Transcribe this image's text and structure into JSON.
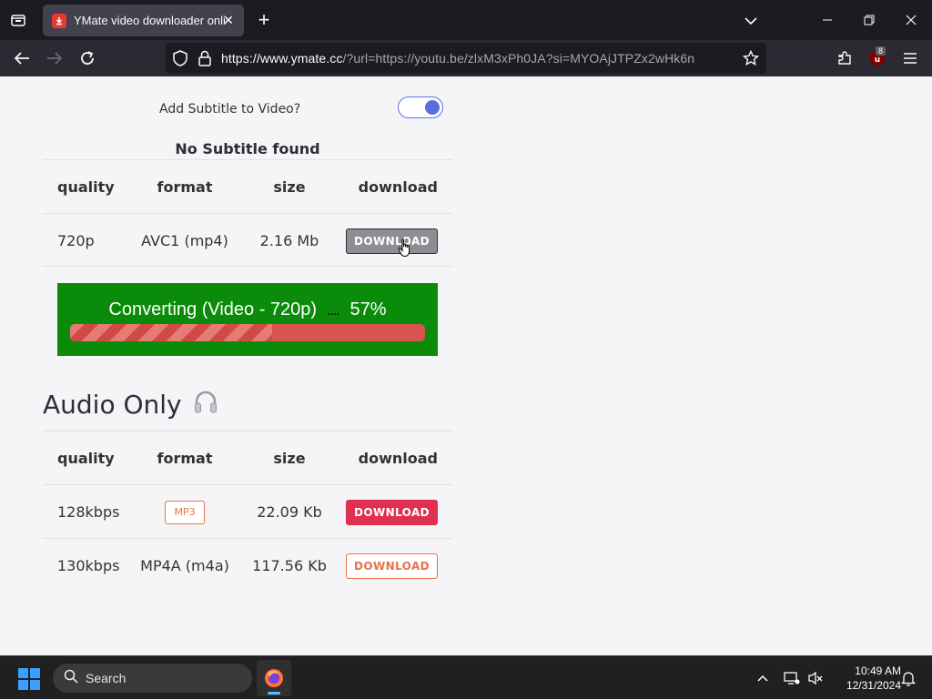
{
  "browser": {
    "tab_title": "YMate video downloader online",
    "url_host": "https://www.ymate.cc",
    "url_rest": "/?url=https://youtu.be/zlxM3xPh0JA?si=MYOAjJTPZx2wHk6n",
    "extension_badge": "8"
  },
  "subtitle": {
    "label": "Add Subtitle to Video?",
    "toggle_on": true,
    "status": "No Subtitle found"
  },
  "video_table": {
    "headers": [
      "quality",
      "format",
      "size",
      "download"
    ],
    "rows": [
      {
        "quality": "720p",
        "format": "AVC1 (mp4)",
        "size": "2.16 Mb",
        "button": "DOWNLOAD"
      }
    ]
  },
  "progress": {
    "label": "Converting (Video - 720p)",
    "dots": "....",
    "percent_text": "57%",
    "percent": 57
  },
  "audio": {
    "title": "Audio Only",
    "headers": [
      "quality",
      "format",
      "size",
      "download"
    ],
    "rows": [
      {
        "quality": "128kbps",
        "format": "MP3",
        "size": "22.09 Kb",
        "button": "DOWNLOAD"
      },
      {
        "quality": "130kbps",
        "format": "MP4A (m4a)",
        "size": "117.56 Kb",
        "button": "DOWNLOAD"
      }
    ]
  },
  "taskbar": {
    "search_label": "Search",
    "time": "10:49 AM",
    "date": "12/31/2024"
  },
  "colors": {
    "accent_red": "#e0304f",
    "outline_orange": "#e8724c",
    "progress_green": "#0a8c0a",
    "toggle_blue": "#5a6ee0"
  }
}
